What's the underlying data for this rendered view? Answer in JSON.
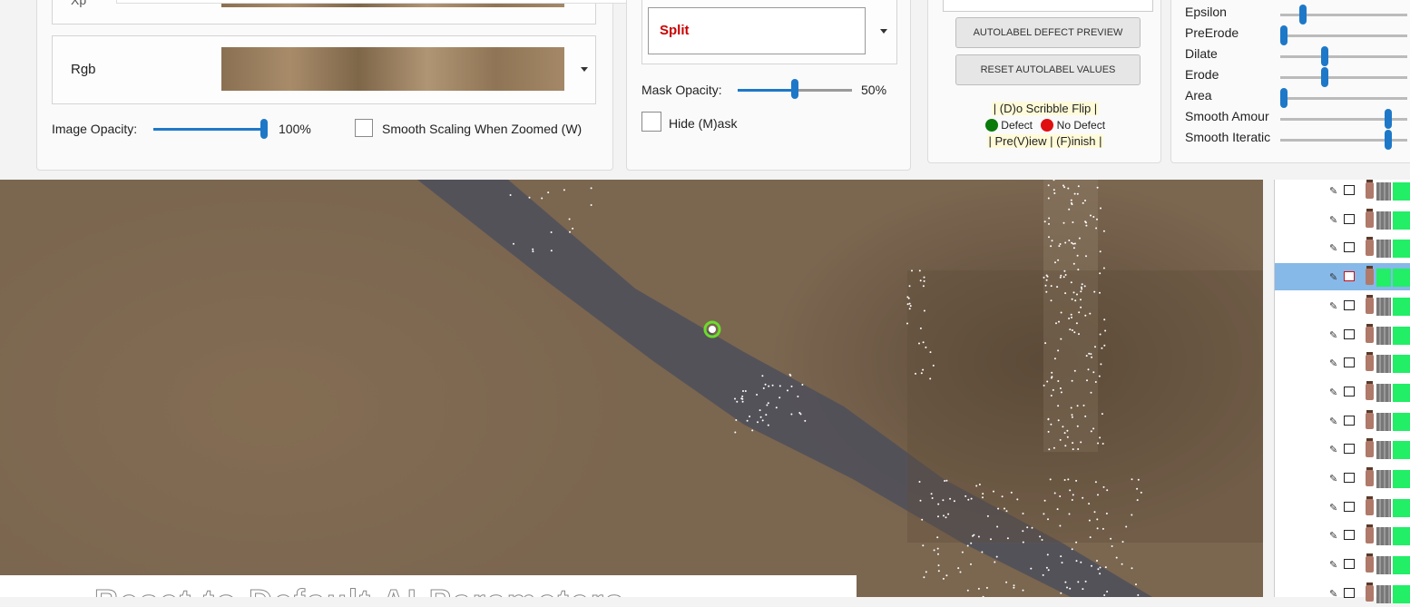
{
  "image_panel": {
    "top_row_label": "Xp",
    "rgb_label": "Rgb",
    "image_opacity_label": "Image Opacity:",
    "image_opacity_value": "100%",
    "image_opacity_level": 1.0,
    "smooth_scaling_label": "Smooth Scaling When Zoomed (W)",
    "smooth_scaling_checked": false
  },
  "mask_panel": {
    "class_selected": "Split",
    "class_color": "#cc0000",
    "mask_opacity_label": "Mask Opacity:",
    "mask_opacity_value": "50%",
    "mask_opacity_level": 0.5,
    "hide_mask_label": "Hide (M)ask",
    "hide_mask_checked": false
  },
  "autolabel_panel": {
    "preview_button": "AUTOLABEL DEFECT PREVIEW",
    "reset_button": "RESET AUTOLABEL VALUES",
    "help_line1": "| (D)o Scribble Flip |",
    "defect_label": "Defect",
    "defect_color": "#0a7a0a",
    "no_defect_label": "No Defect",
    "no_defect_color": "#e01010",
    "help_line2": "| Pre(V)iew | (F)inish |"
  },
  "params_panel": {
    "items": [
      {
        "label": "Epsilon",
        "level": 0.15
      },
      {
        "label": "PreErode",
        "level": 0.0
      },
      {
        "label": "Dilate",
        "level": 0.32
      },
      {
        "label": "Erode",
        "level": 0.32
      },
      {
        "label": "Area",
        "level": 0.0
      },
      {
        "label": "Smooth Amour",
        "level": 0.82
      },
      {
        "label": "Smooth Iteratic",
        "level": 0.82
      }
    ]
  },
  "bottom_overlay": {
    "text": "Reset to Default AI Parameters"
  },
  "annotation_list": {
    "row_count": 15,
    "selected_index": 3,
    "icons": [
      "pencil-icon",
      "checkbox-icon",
      "bottle-icon",
      "mask-swatch-icon",
      "label-color-icon"
    ]
  },
  "colors": {
    "accent": "#1e78c8",
    "selection": "#86b8e8",
    "label_green": "#22ee66"
  }
}
